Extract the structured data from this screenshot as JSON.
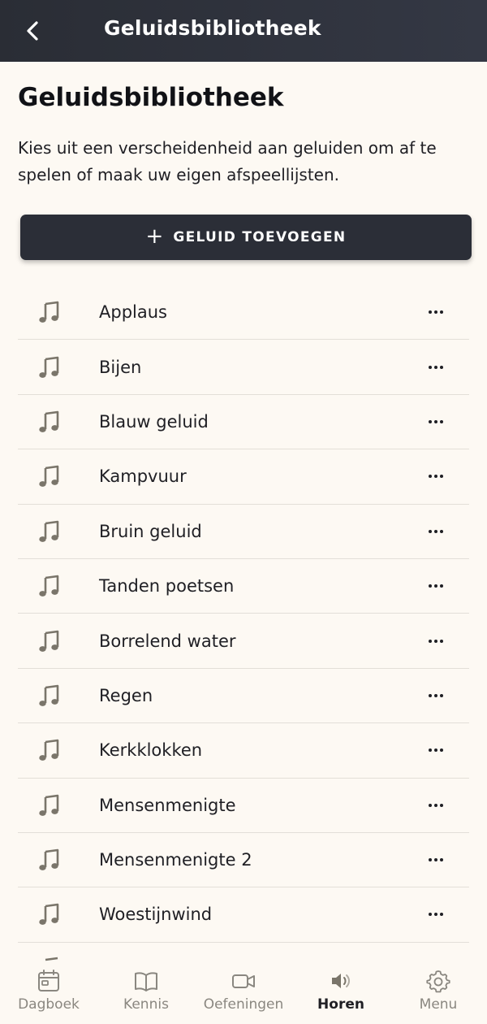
{
  "header": {
    "title": "Geluidsbibliotheek",
    "back_icon": "chevron-left-icon"
  },
  "page": {
    "title": "Geluidsbibliotheek",
    "description": "Kies uit een verscheidenheid aan geluiden om af te spelen of maak uw eigen afspeellijsten."
  },
  "add_button": {
    "icon": "plus-icon",
    "label": "GELUID TOEVOEGEN"
  },
  "sounds": [
    {
      "name": "Applaus"
    },
    {
      "name": "Bijen"
    },
    {
      "name": "Blauw geluid"
    },
    {
      "name": "Kampvuur"
    },
    {
      "name": "Bruin geluid"
    },
    {
      "name": "Tanden poetsen"
    },
    {
      "name": "Borrelend water"
    },
    {
      "name": "Regen"
    },
    {
      "name": "Kerkklokken"
    },
    {
      "name": "Mensenmenigte"
    },
    {
      "name": "Mensenmenigte 2"
    },
    {
      "name": "Woestijnwind"
    }
  ],
  "bottom_nav": {
    "items": [
      {
        "label": "Dagboek",
        "icon": "calendar-icon"
      },
      {
        "label": "Kennis",
        "icon": "book-icon"
      },
      {
        "label": "Oefeningen",
        "icon": "video-camera-icon"
      },
      {
        "label": "Horen",
        "icon": "speaker-icon"
      },
      {
        "label": "Menu",
        "icon": "gear-icon"
      }
    ],
    "active": "Horen"
  },
  "colors": {
    "header_bg": "#2a2d35",
    "page_bg": "#fdf9f3",
    "button_bg": "#2b2e37",
    "note_icon": "#7a756a",
    "nav_inactive": "#8a8780",
    "nav_active": "#1f1f24"
  }
}
